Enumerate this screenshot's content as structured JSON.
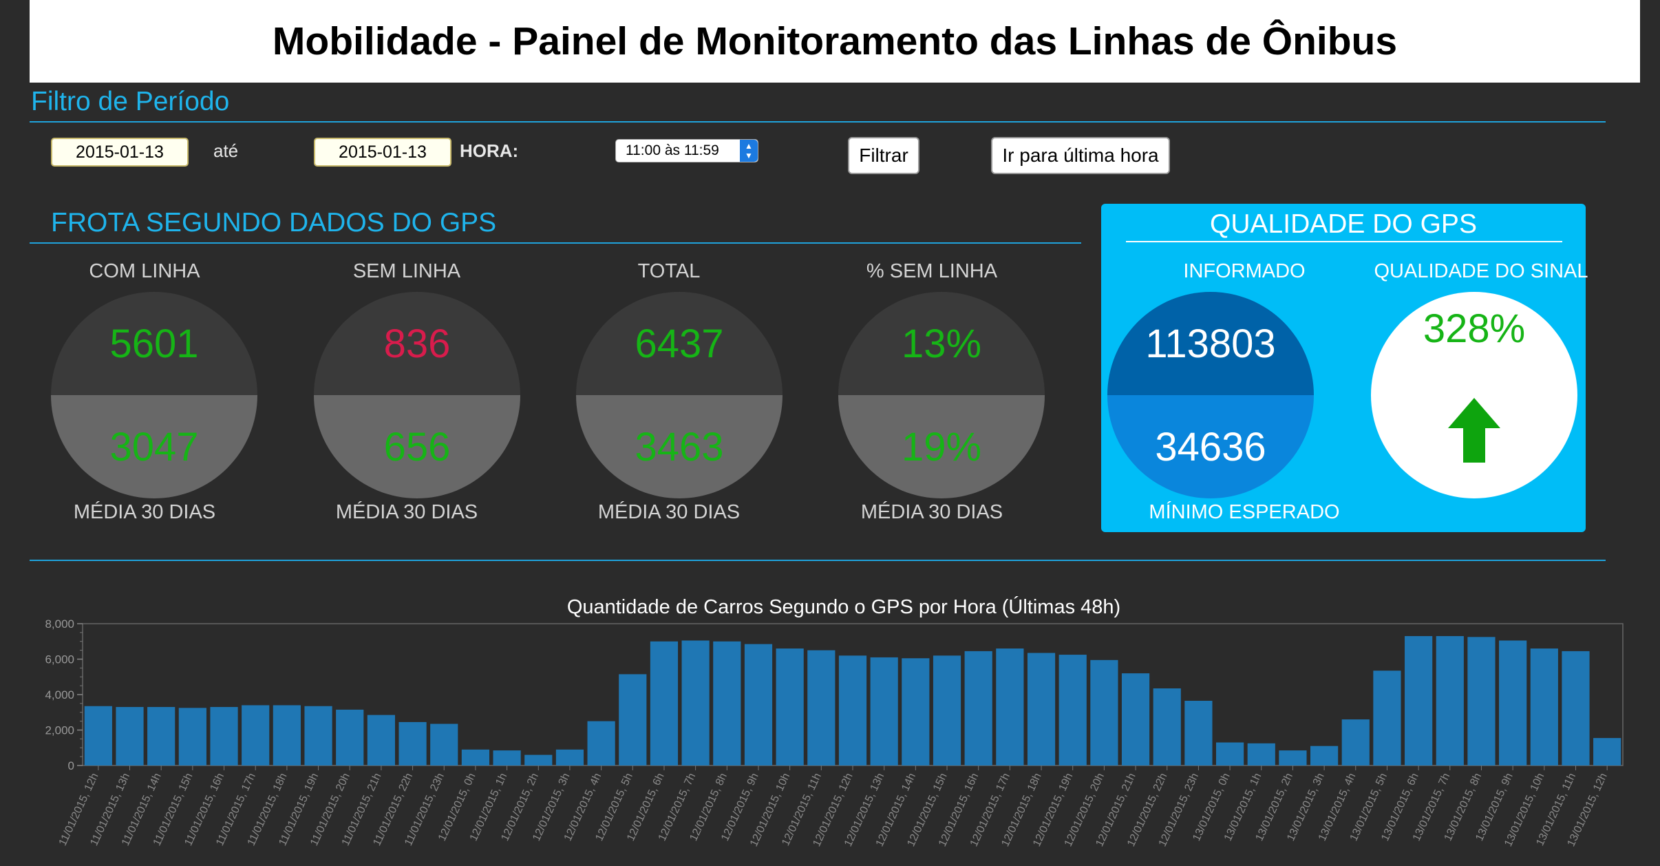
{
  "header": {
    "title": "Mobilidade - Painel de Monitoramento das Linhas de Ônibus"
  },
  "filter": {
    "section_title": "Filtro de Período",
    "start_date": "2015-01-13",
    "until_label": "até",
    "end_date": "2015-01-13",
    "hour_label": "HORA:",
    "hour_selected": "11:00 às 11:59",
    "filter_button": "Filtrar",
    "last_hour_button": "Ir para última hora"
  },
  "fleet": {
    "section_title": "FROTA SEGUNDO DADOS DO GPS",
    "footer_label": "MÉDIA 30 DIAS",
    "metrics": [
      {
        "label": "COM LINHA",
        "value": "5601",
        "avg": "3047",
        "value_color": "green"
      },
      {
        "label": "SEM LINHA",
        "value": "836",
        "avg": "656",
        "value_color": "red"
      },
      {
        "label": "TOTAL",
        "value": "6437",
        "avg": "3463",
        "value_color": "green"
      },
      {
        "label": "% SEM LINHA",
        "value": "13%",
        "avg": "19%",
        "value_color": "green"
      }
    ]
  },
  "gps_quality": {
    "title": "QUALIDADE DO GPS",
    "informed_label": "INFORMADO",
    "informed_value": "113803",
    "expected_value": "34636",
    "expected_label": "MÍNIMO ESPERADO",
    "signal_label": "QUALIDADE DO SINAL",
    "signal_value": "328%",
    "signal_icon": "arrow-up-icon"
  },
  "colors": {
    "accent": "#1fb4ec",
    "bar": "#1f77b4",
    "good": "#16b416",
    "bad": "#d81c4c",
    "panel": "#00bdf7"
  },
  "chart_data": {
    "type": "bar",
    "title": "Quantidade de Carros Segundo o GPS por Hora (Últimas 48h)",
    "xlabel": "",
    "ylabel": "",
    "ylim": [
      0,
      8000
    ],
    "yticks": [
      "0",
      "2,000",
      "4,000",
      "6,000",
      "8,000"
    ],
    "grid": false,
    "categories": [
      "11/01/2015, 12h",
      "11/01/2015, 13h",
      "11/01/2015, 14h",
      "11/01/2015, 15h",
      "11/01/2015, 16h",
      "11/01/2015, 17h",
      "11/01/2015, 18h",
      "11/01/2015, 19h",
      "11/01/2015, 20h",
      "11/01/2015, 21h",
      "11/01/2015, 22h",
      "11/01/2015, 23h",
      "12/01/2015, 0h",
      "12/01/2015, 1h",
      "12/01/2015, 2h",
      "12/01/2015, 3h",
      "12/01/2015, 4h",
      "12/01/2015, 5h",
      "12/01/2015, 6h",
      "12/01/2015, 7h",
      "12/01/2015, 8h",
      "12/01/2015, 9h",
      "12/01/2015, 10h",
      "12/01/2015, 11h",
      "12/01/2015, 12h",
      "12/01/2015, 13h",
      "12/01/2015, 14h",
      "12/01/2015, 15h",
      "12/01/2015, 16h",
      "12/01/2015, 17h",
      "12/01/2015, 18h",
      "12/01/2015, 19h",
      "12/01/2015, 20h",
      "12/01/2015, 21h",
      "12/01/2015, 22h",
      "12/01/2015, 23h",
      "13/01/2015, 0h",
      "13/01/2015, 1h",
      "13/01/2015, 2h",
      "13/01/2015, 3h",
      "13/01/2015, 4h",
      "13/01/2015, 5h",
      "13/01/2015, 6h",
      "13/01/2015, 7h",
      "13/01/2015, 8h",
      "13/01/2015, 9h",
      "13/01/2015, 10h",
      "13/01/2015, 11h",
      "13/01/2015, 12h"
    ],
    "values": [
      3350,
      3300,
      3300,
      3250,
      3300,
      3400,
      3400,
      3350,
      3150,
      2850,
      2450,
      2350,
      900,
      850,
      600,
      900,
      2500,
      5150,
      7000,
      7050,
      7000,
      6850,
      6600,
      6500,
      6200,
      6100,
      6050,
      6200,
      6450,
      6600,
      6350,
      6250,
      5950,
      5200,
      4350,
      3650,
      1300,
      1250,
      850,
      1100,
      2600,
      5350,
      7300,
      7300,
      7250,
      7050,
      6600,
      6450,
      1550
    ]
  }
}
